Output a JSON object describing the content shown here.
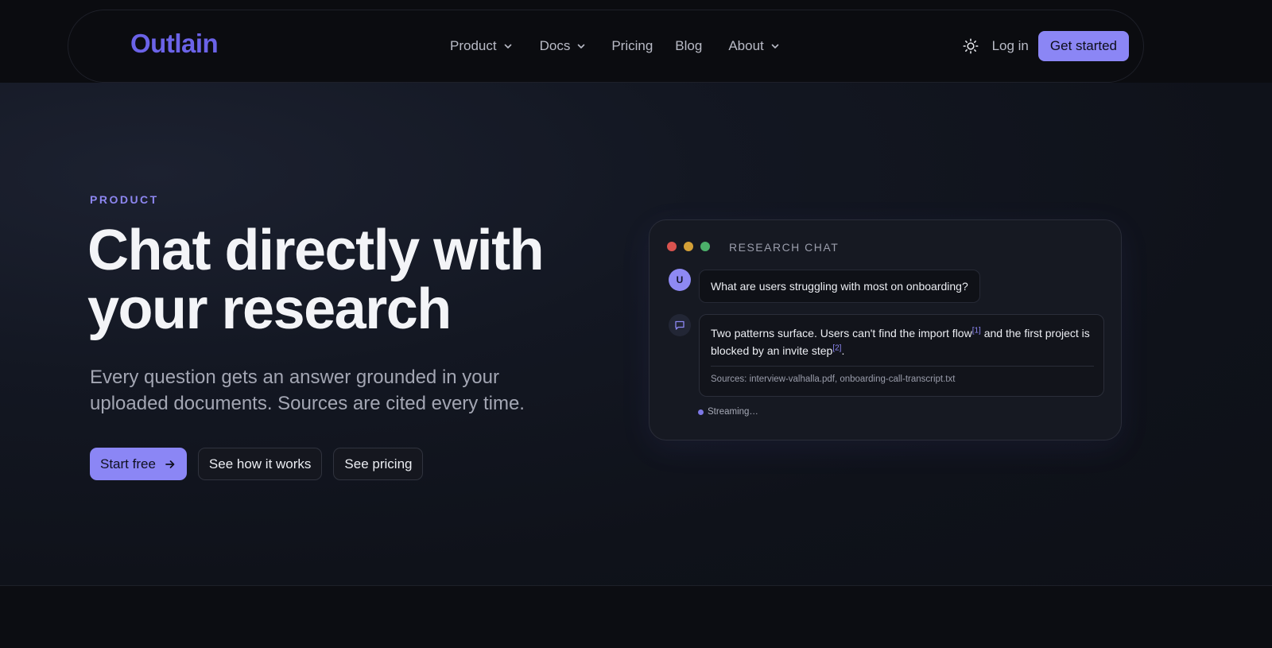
{
  "brand": {
    "logo_text": "Outlain",
    "accent": "#8b86f5",
    "logo_color": "#6b63e8"
  },
  "nav": {
    "items": [
      {
        "label": "Product",
        "dropdown": true
      },
      {
        "label": "Docs",
        "dropdown": true
      },
      {
        "label": "Pricing",
        "dropdown": false
      },
      {
        "label": "Blog",
        "dropdown": false
      },
      {
        "label": "About",
        "dropdown": true
      }
    ],
    "theme_icon": "sun-icon",
    "login_label": "Log in",
    "cta_label": "Get started"
  },
  "hero": {
    "eyebrow": "PRODUCT",
    "headline_line1": "Chat directly with",
    "headline_line2": "your research",
    "subheadline_line1": "Every question gets an answer grounded in your",
    "subheadline_line2": "uploaded documents. Sources are cited every time.",
    "buttons": {
      "start_free": "Start free",
      "how_it_works": "See how it works",
      "pricing": "See pricing"
    }
  },
  "chat": {
    "title": "RESEARCH CHAT",
    "window_dots": [
      "#d9534f",
      "#d4a037",
      "#4caf6a"
    ],
    "user_avatar": "U",
    "user_message": "What are users struggling with most on onboarding?",
    "answer_part1": "Two patterns surface. Users can't find the import flow",
    "cite1": "[1]",
    "answer_part2": " and the first project is blocked by an invite step",
    "cite2": "[2]",
    "answer_end": ".",
    "sources": "Sources: interview-valhalla.pdf, onboarding-call-transcript.txt",
    "status": "Streaming…"
  }
}
